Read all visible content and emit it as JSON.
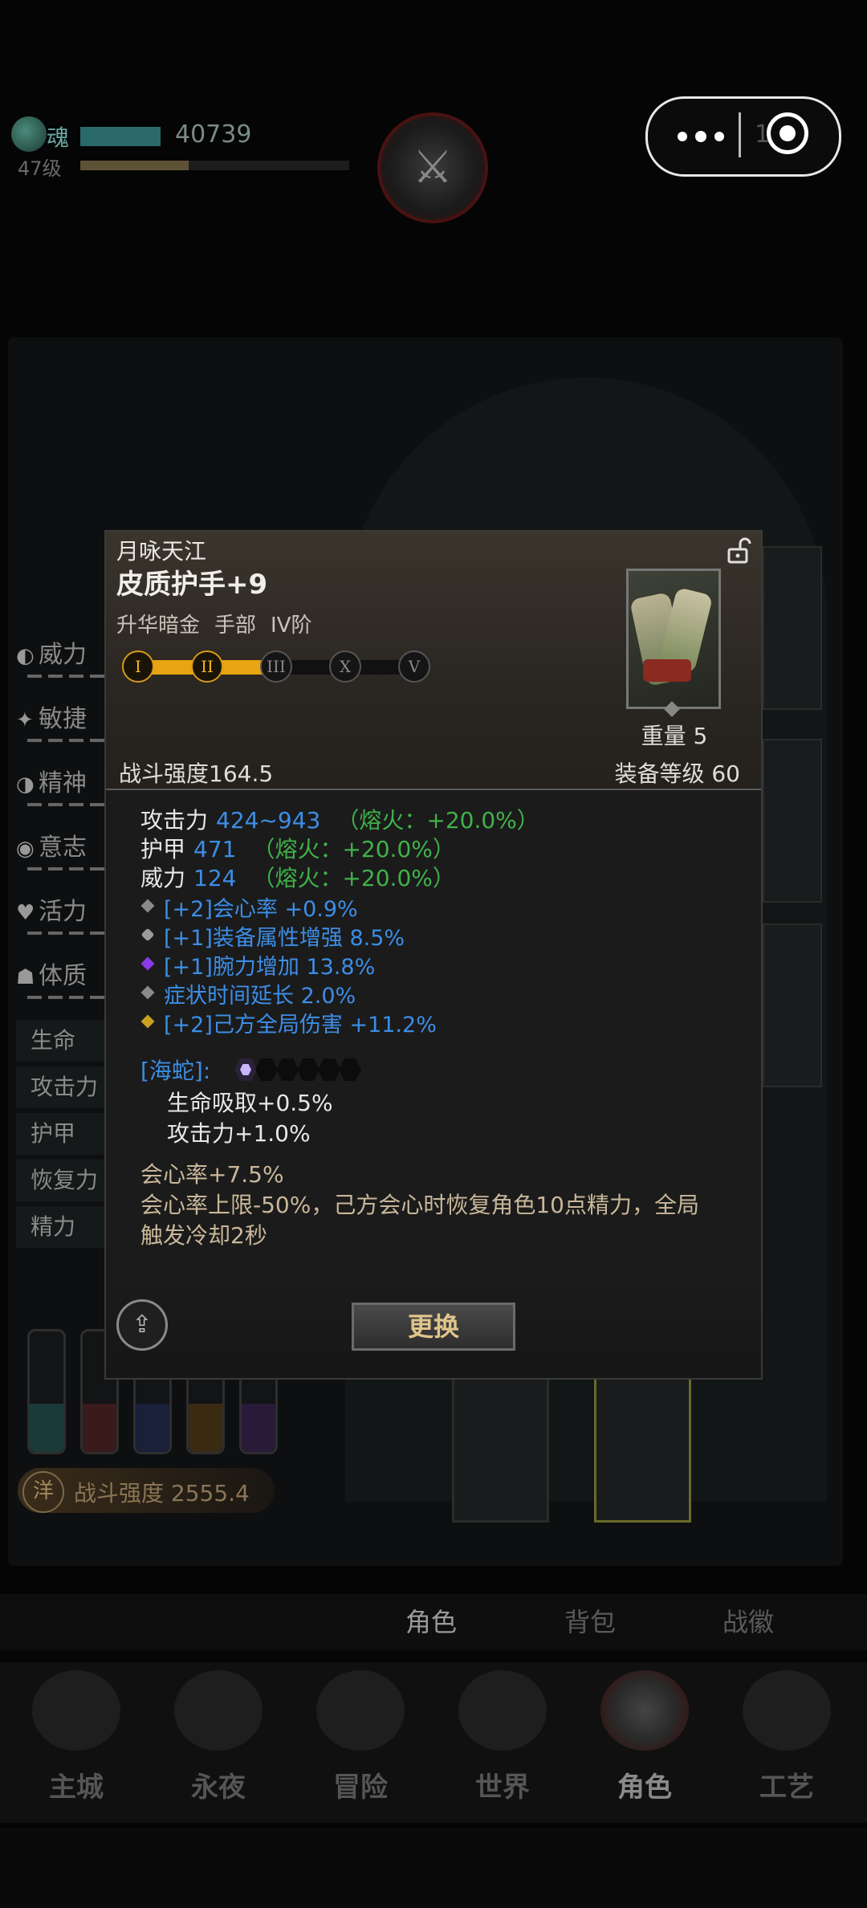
{
  "topbar": {
    "soul_label": "魂",
    "soul_value": "40739",
    "level_label": "47级",
    "menu_dots_icon": "more-dots-icon",
    "target_icon": "close-target-icon",
    "peek_text": "1"
  },
  "side_stats": {
    "primary": [
      {
        "label": "威力",
        "icon": "power-icon"
      },
      {
        "label": "敏捷",
        "icon": "agility-icon"
      },
      {
        "label": "精神",
        "icon": "spirit-icon"
      },
      {
        "label": "意志",
        "icon": "will-icon"
      },
      {
        "label": "活力",
        "icon": "vitality-icon"
      },
      {
        "label": "体质",
        "icon": "constitution-icon"
      }
    ],
    "secondary": [
      "生命",
      "攻击力",
      "护甲",
      "恢复力",
      "精力"
    ]
  },
  "power_badge": {
    "emblem": "洋",
    "text": "战斗强度 2555.4"
  },
  "sub_tabs": [
    "角色",
    "背包",
    "战徽"
  ],
  "nav": [
    "主城",
    "永夜",
    "冒险",
    "世界",
    "角色",
    "工艺"
  ],
  "item": {
    "set_name": "月咏天江",
    "title": "皮质护手+9",
    "meta": [
      "升华暗金",
      "手部",
      "IV阶"
    ],
    "tiers": [
      "I",
      "II",
      "III",
      "X",
      "Ⅴ"
    ],
    "weight": "重量 5",
    "combat_power": "战斗强度164.5",
    "gear_level": "装备等级 60",
    "base_attrs": [
      {
        "label": "攻击力",
        "value": "424~943",
        "bonus": "（熔火：+20.0%）"
      },
      {
        "label": "护甲",
        "value": "471",
        "bonus": "（熔火：+20.0%）"
      },
      {
        "label": "威力",
        "value": "124",
        "bonus": "（熔火：+20.0%）"
      }
    ],
    "affixes": [
      {
        "text": "[+2]会心率 +0.9%",
        "color": "#8a8a8a"
      },
      {
        "text": "[+1]装备属性增强 8.5%",
        "color": "#9a9a9a"
      },
      {
        "text": "[+1]腕力增加 13.8%",
        "color": "#8a3ae6"
      },
      {
        "text": "症状时间延长 2.0%",
        "color": "#8a8a8a"
      },
      {
        "text": "[+2]己方全局伤害 +11.2%",
        "color": "#c9a020"
      }
    ],
    "set_bonus_title": "[海蛇]:",
    "set_bonus_lines": [
      "生命吸取+0.5%",
      "攻击力+1.0%"
    ],
    "desc_line1": "会心率+7.5%",
    "desc_line2": "会心率上限-50%，己方会心时恢复角色10点精力，全局触发冷却2秒",
    "swap_label": "更换",
    "share_icon": "share-icon",
    "lock_icon": "unlock-icon"
  }
}
